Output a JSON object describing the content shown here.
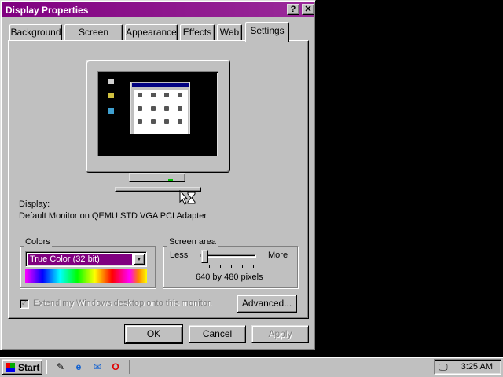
{
  "window": {
    "title": "Display Properties",
    "help_button": "?",
    "close_button": "✕"
  },
  "tabs": [
    {
      "label": "Background"
    },
    {
      "label": "Screen Saver"
    },
    {
      "label": "Appearance"
    },
    {
      "label": "Effects"
    },
    {
      "label": "Web"
    },
    {
      "label": "Settings",
      "active": true
    }
  ],
  "display": {
    "label": "Display:",
    "value": "Default Monitor on QEMU STD VGA PCI Adapter"
  },
  "colors": {
    "legend": "Colors",
    "selected": "True Color (32 bit)"
  },
  "screen_area": {
    "legend": "Screen area",
    "less_label": "Less",
    "more_label": "More",
    "resolution_text": "640 by 480 pixels",
    "slider_position": 0
  },
  "extend_checkbox": {
    "label": "Extend my Windows desktop onto this monitor.",
    "checked": true,
    "disabled": true
  },
  "buttons": {
    "advanced": "Advanced...",
    "ok": "OK",
    "cancel": "Cancel",
    "apply": "Apply"
  },
  "taskbar": {
    "start_label": "Start",
    "clock": "3:25 AM",
    "quick_launch_icons": [
      "desktop-icon",
      "internet-explorer-icon",
      "outlook-express-icon",
      "opera-icon"
    ]
  },
  "colors_accent": {
    "titlebar": "#800080",
    "selection": "#800080",
    "face": "#c0c0c0"
  }
}
